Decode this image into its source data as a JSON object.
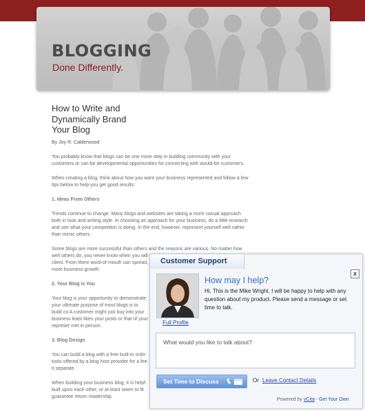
{
  "hero": {
    "title": "BLOGGING",
    "tagline": "Done Differently."
  },
  "article": {
    "title": "How to Write and Dynamically Brand Your Blog",
    "author": "By Joy R. Calderwood",
    "paragraphs": [
      "You probably know that blogs can be one more step in building community with your customers or can be developmental opportunities for connecting with would-be customers.",
      "When creating a blog, think about how you want your business represented and follow a few tips below to help you get good results:",
      "1. Ideas From Others",
      "Trends continue to change. Many blogs and websites are taking a more casual approach both in look and writing style. In choosing an approach for your business, do a little research and see what your competition is doing. In the end, however, represent yourself well rather than mimic others.",
      "Some blogs are more successful than others and the reasons are various. No matter how well others do, you never know when you will get that one lucky hit that brings in your next client. From there word-of-mouth can spread, so your blog always presents an opportunity for more business growth.",
      "2. Your Blog is You",
      "Your blog is your opportunity to demonstrate your ultimate purpose of most blogs is to build co A customer might just buy into your business least likes your posts or that of your represer met in person.",
      "3. Blog Design",
      "You can build a blog with a free built-in onlin tools offered by a blog host provider for a fee it separate.",
      "When building your business blog, it is helpf built upon each other, or at least seem to fit guarantee return readership."
    ]
  },
  "chat": {
    "tab_label": "Customer Support",
    "close_label": "x",
    "profile_link": "Full Profile",
    "heading": "How may I help?",
    "intro": "Hi, This is the Mike Wright. I will be happy to help with any question about my product. Please send a message or set time to talk.",
    "message_placeholder": "What would you like to talk about?",
    "set_time_button": "Set Time to Discuss",
    "or_label": "Or",
    "leave_details_link": "Leave Contact Details",
    "powered_by": "Powered by",
    "powered_brand": "vCita",
    "powered_cta": "- Get Your Own",
    "colors": {
      "accent": "#2f6fc0",
      "link": "#22489a",
      "button": "#5f92d6",
      "header_bar": "#8e1f1f"
    }
  },
  "icons": [
    "phone-icon",
    "calendar-icon"
  ]
}
